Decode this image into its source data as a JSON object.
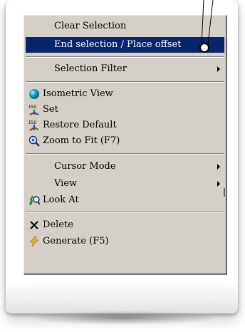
{
  "menu": {
    "items": [
      {
        "label": "Clear Selection",
        "icon": null
      },
      {
        "label": "End selection / Place offset",
        "icon": null,
        "selected": true
      },
      {
        "label": "Selection Filter",
        "icon": null,
        "submenu": true
      },
      {
        "label": "Isometric View",
        "icon": "sphere-icon"
      },
      {
        "label": "Set",
        "icon": "iso-set-icon"
      },
      {
        "label": "Restore Default",
        "icon": "iso-restore-icon"
      },
      {
        "label": "Zoom to Fit (F7)",
        "icon": "zoom-fit-icon"
      },
      {
        "label": "Cursor Mode",
        "icon": null,
        "submenu": true
      },
      {
        "label": "View",
        "icon": null,
        "submenu": true
      },
      {
        "label": "Look At",
        "icon": "look-at-icon"
      },
      {
        "label": "Delete",
        "icon": "delete-x-icon"
      },
      {
        "label": "Generate (F5)",
        "icon": "lightning-icon"
      }
    ],
    "iso_text": "ISO"
  },
  "colors": {
    "menu_bg": "#d4d0c8",
    "highlight": "#0a246a",
    "highlight_text": "#ffffff",
    "sphere": "#1fa6c9",
    "lightning": "#f2c21b"
  }
}
